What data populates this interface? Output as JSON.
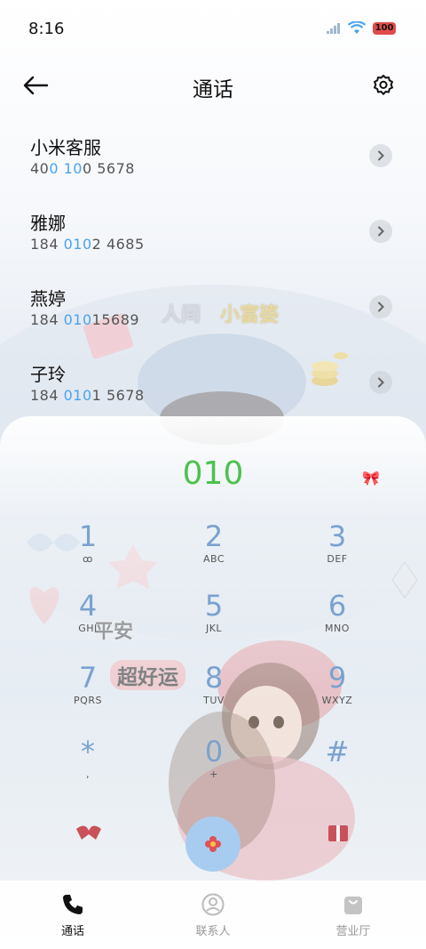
{
  "status_bar": {
    "time": "8:16",
    "battery": "100"
  },
  "header": {
    "title": "通话"
  },
  "contacts": [
    {
      "name": "小米客服",
      "number_pre": "40",
      "number_hl": "0 10",
      "number_post": "0 5678"
    },
    {
      "name": "雅娜",
      "number_pre": "184 ",
      "number_hl": "010",
      "number_post": "2 4685"
    },
    {
      "name": "燕婷",
      "number_pre": "184 ",
      "number_hl": "010",
      "number_post": "15689"
    },
    {
      "name": "子玲",
      "number_pre": "184 ",
      "number_hl": "010",
      "number_post": "1 5678"
    }
  ],
  "dialpad": {
    "dialed_number": "010",
    "keys": [
      {
        "digit": "1",
        "letters": "ꝏ"
      },
      {
        "digit": "2",
        "letters": "ABC"
      },
      {
        "digit": "3",
        "letters": "DEF"
      },
      {
        "digit": "4",
        "letters": "GHI"
      },
      {
        "digit": "5",
        "letters": "JKL"
      },
      {
        "digit": "6",
        "letters": "MNO"
      },
      {
        "digit": "7",
        "letters": "PQRS"
      },
      {
        "digit": "8",
        "letters": "TUV"
      },
      {
        "digit": "9",
        "letters": "WXYZ"
      },
      {
        "digit": "*",
        "letters": ","
      },
      {
        "digit": "0",
        "letters": "+"
      },
      {
        "digit": "#",
        "letters": ""
      }
    ]
  },
  "wallpaper_text": {
    "line1a": "人间",
    "line1b": "小富婆",
    "line2": "平安",
    "line3": "超好运"
  },
  "bottom_nav": {
    "calls": "通话",
    "contacts": "联系人",
    "service_hall": "营业厅"
  },
  "colors": {
    "dialed_number": "#4cc24c",
    "highlight": "#4aa3ec",
    "key_digit": "#7aa2cf",
    "call_button": "#a8ccef"
  }
}
